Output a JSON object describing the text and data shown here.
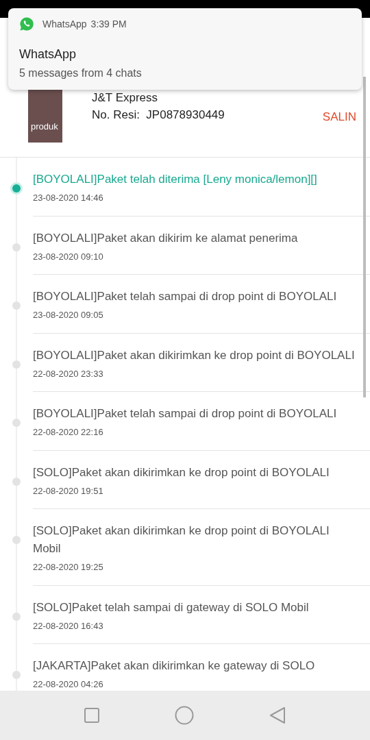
{
  "notification": {
    "app": "WhatsApp",
    "time": "3:39 PM",
    "title": "WhatsApp",
    "text": "5 messages from 4 chats"
  },
  "shipment": {
    "photo_label": "produk",
    "courier": "J&T Express",
    "receipt_label": "No. Resi:",
    "receipt": "JP0878930449",
    "copy_button": "SALIN"
  },
  "timeline": [
    {
      "text": "[BOYOLALI]Paket telah diterima [Leny monica/lemon][]",
      "date": "23-08-2020 14:46",
      "active": true
    },
    {
      "text": "[BOYOLALI]Paket akan dikirim ke alamat penerima",
      "date": "23-08-2020 09:10",
      "active": false
    },
    {
      "text": "[BOYOLALI]Paket telah sampai di drop point di BOYOLALI",
      "date": "23-08-2020 09:05",
      "active": false
    },
    {
      "text": "[BOYOLALI]Paket akan dikirimkan ke drop point di BOYOLALI",
      "date": "22-08-2020 23:33",
      "active": false
    },
    {
      "text": "[BOYOLALI]Paket telah sampai di drop point di BOYOLALI",
      "date": "22-08-2020 22:16",
      "active": false
    },
    {
      "text": "[SOLO]Paket akan dikirimkan ke drop point di BOYOLALI",
      "date": "22-08-2020 19:51",
      "active": false
    },
    {
      "text": "[SOLO]Paket akan dikirimkan ke drop point di BOYOLALI Mobil",
      "date": "22-08-2020 19:25",
      "active": false
    },
    {
      "text": "[SOLO]Paket telah sampai di gateway di SOLO Mobil",
      "date": "22-08-2020 16:43",
      "active": false
    },
    {
      "text": "[JAKARTA]Paket akan dikirimkan ke gateway di SOLO",
      "date": "22-08-2020 04:26",
      "active": false
    }
  ]
}
